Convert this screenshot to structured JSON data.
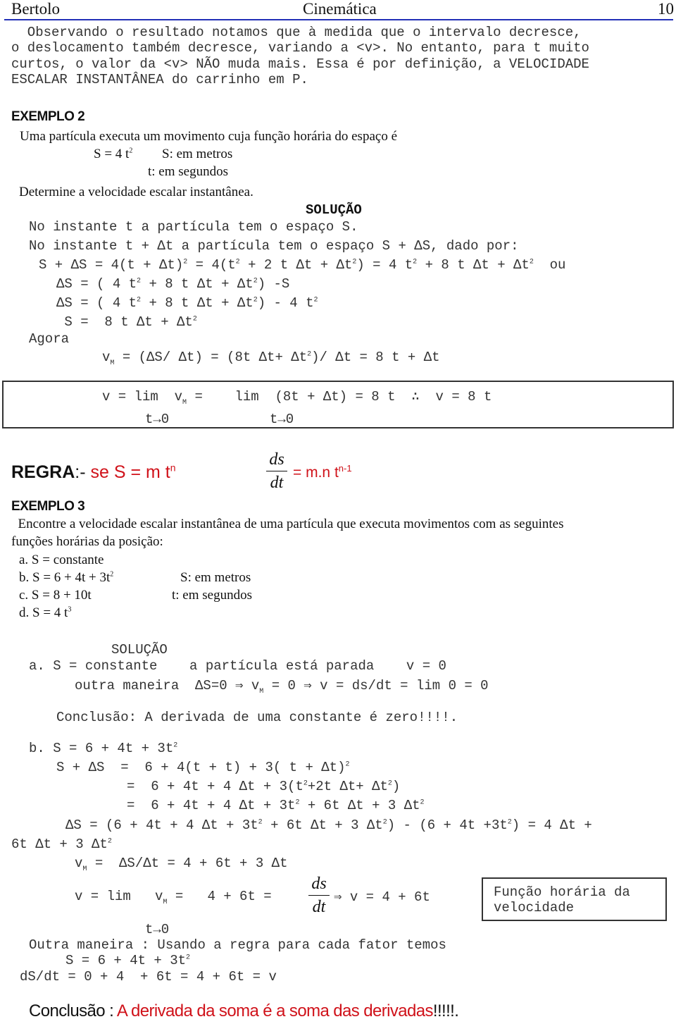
{
  "header": {
    "author": "Bertolo",
    "title": "Cinemática",
    "page_number": "10",
    "rule_color": "#2230b8"
  },
  "intro": {
    "lines": [
      "  Observando o resultado notamos que à medida que o intervalo decresce,",
      "o deslocamento também decresce, variando a <v>. No entanto, para t muito",
      "curtos, o valor da <v> NÃO muda mais. Essa é por definição, a VELOCIDADE",
      "ESCALAR INSTANTÂNEA do carrinho em P."
    ]
  },
  "example2": {
    "title": "EXEMPLO 2",
    "statement": "Uma partícula executa um movimento cuja função horária do espaço é",
    "equation": "S = 4 t",
    "equation_exp": "2",
    "unit_s": "S: em metros",
    "unit_t": "t: em segundos",
    "question": "Determine a velocidade escalar instantânea.",
    "solution_label": "SOLUÇÃO",
    "steps": {
      "l1": "No instante t a partícula tem o espaço S.",
      "l2": "No instante t + Δt a partícula tem o espaço S + ΔS, dado por:",
      "l3a": "S + ΔS = 4(t + Δt)",
      "l3b": " = 4(t",
      "l3c": " + 2 t Δt + Δt",
      "l3d": ") = 4 t",
      "l3e": " + 8 t Δt + Δt",
      "l3f": "  ou",
      "l4a": "ΔS = ( 4 t",
      "l4b": " + 8 t Δt + Δt",
      "l4c": ") -S",
      "l5a": "ΔS = ( 4 t",
      "l5b": " + 8 t Δt + Δt",
      "l5c": ") - 4 t",
      "l6a": " S =  8 t Δt + Δt",
      "l7": "Agora",
      "l8a": "v",
      "l8sub": "M",
      "l8b": " = (ΔS/ Δt) = (8t Δt+ Δt",
      "l8c": ")/ Δt = 8 t + Δt",
      "exp": "2"
    },
    "limit_box": {
      "l1a": "v = lim  v",
      "l1sub": "M",
      "l1b": " =    lim  (8t + Δt) = 8 t  ∴  v = 8 t",
      "l2a": "t→0",
      "l2b": "t→0"
    }
  },
  "rule": {
    "label": "REGRA",
    "sep": ":- ",
    "cond": "se S = m t",
    "cond_exp": "n",
    "frac_num": "ds",
    "frac_den": "dt",
    "result": "= m.n t",
    "result_exp": "n-1",
    "accent_color": "#d0121a"
  },
  "example3": {
    "title": "EXEMPLO 3",
    "statement_l1": "  Encontre a velocidade escalar instantânea de uma partícula que executa movimentos com as seguintes",
    "statement_l2": "funções horárias da posição:",
    "items": [
      {
        "text": "a. S = constante",
        "exp": ""
      },
      {
        "text": "b. S = 6 + 4t + 3t",
        "exp": "2"
      },
      {
        "text": "c. S = 8 + 10t",
        "exp": ""
      },
      {
        "text": "d. S = 4 t",
        "exp": "3"
      }
    ],
    "unit_s": "S: em metros",
    "unit_t": "t: em segundos",
    "solution_label": "SOLUÇÃO",
    "part_a": {
      "l1": "a. S = constante    a partícula está parada    v = 0",
      "l2a": "outra maneira  ΔS=0 ⇒ v",
      "l2sub": "M",
      "l2b": " = 0 ⇒ v = ds/dt = lim 0 = 0",
      "conclusion": "Conclusão: A derivada de uma constante é zero!!!!."
    },
    "part_b": {
      "l1a": "b. S = 6 + 4t + 3t",
      "l2a": "S + ΔS  =  6 + 4(t + t) + 3( t + Δt)",
      "l3a": "=  6 + 4t + 4 Δt + 3(t",
      "l3b": "+2t Δt+ Δt",
      "l3c": ")",
      "l4a": "=  6 + 4t + 4 Δt + 3t",
      "l4b": " + 6t Δt + 3 Δt",
      "l5a": "ΔS = (6 + 4t + 4 Δt + 3t",
      "l5b": " + 6t Δt + 3 Δt",
      "l5c": ") - (6 + 4t +3t",
      "l5d": ") = 4 Δt +",
      "l6a": "6t Δt + 3 Δt",
      "l7a": "v",
      "l7sub": "M",
      "l7b": " =  ΔS/Δt = 4 + 6t + 3 Δt",
      "l8a": "v = lim   v",
      "l8sub": "M",
      "l8b": " =   4 + 6t = ",
      "l8frac_num": "ds",
      "l8frac_den": "dt",
      "l8c": "⇒ v = 4 + 6t",
      "l9": "t→0",
      "box_l1": "Função horária da",
      "box_l2": "velocidade",
      "l10": "Outra maneira : Usando a regra para cada fator temos",
      "l11a": "S = 6 + 4t + 3t",
      "l12": "dS/dt = 0 + 4  + 6t = 4 + 6t = v",
      "exp": "2"
    },
    "final_conclusion": {
      "label": "Conclusão : ",
      "text": "A derivada da soma é a soma das derivadas",
      "tail": "!!!!!."
    }
  }
}
